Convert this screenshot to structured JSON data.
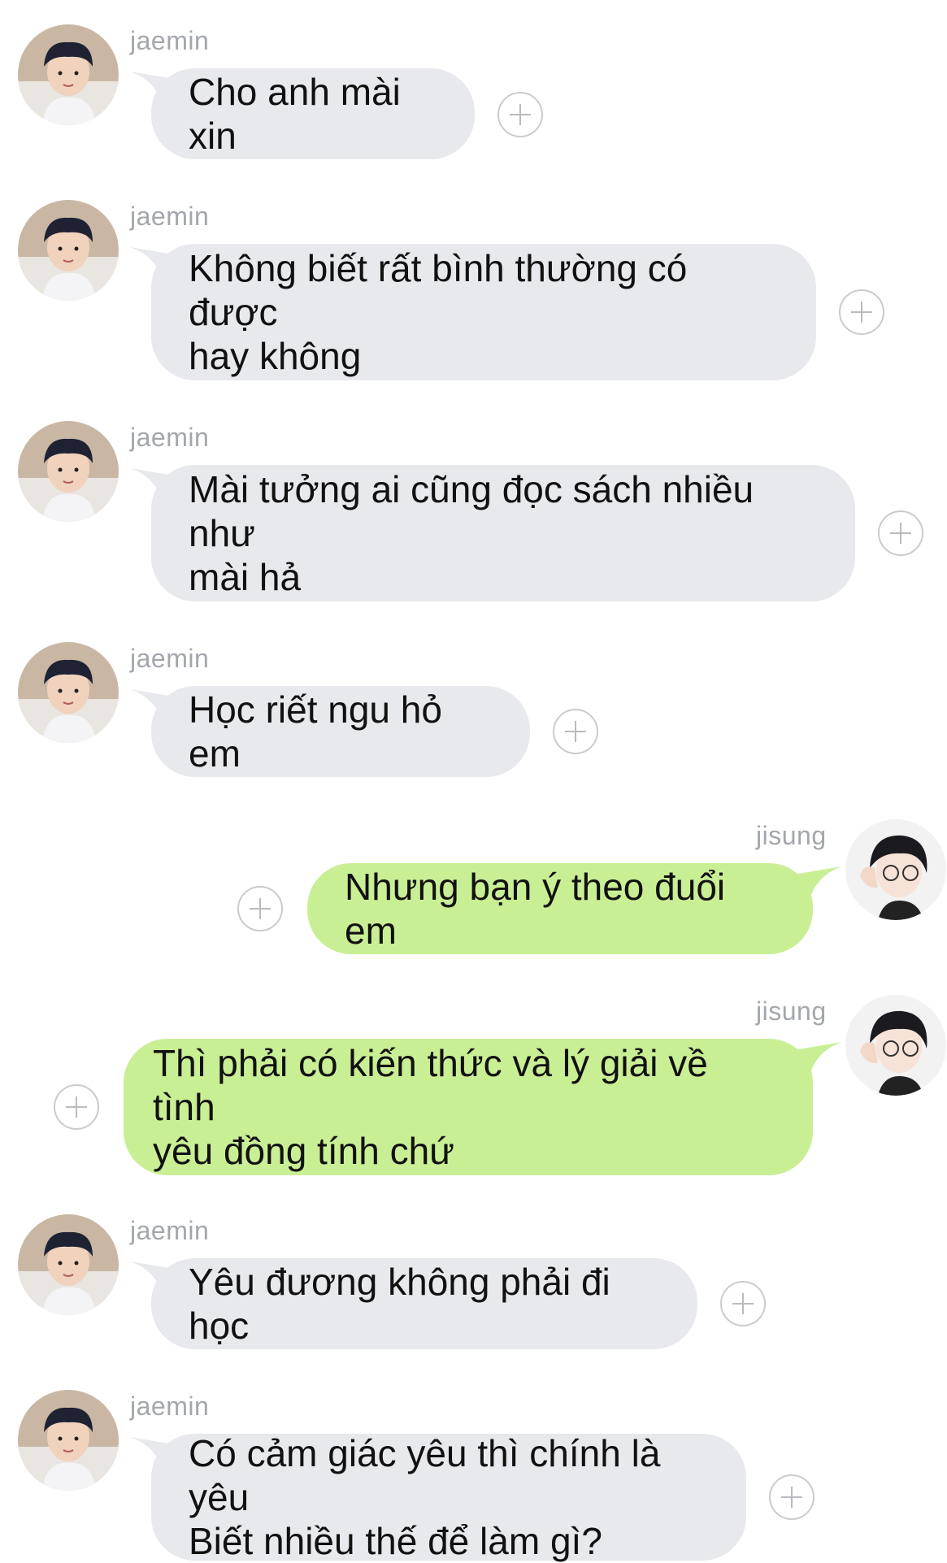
{
  "chat": {
    "messages": [
      {
        "sender": "jaemin",
        "text": "Cho anh mài xin"
      },
      {
        "sender": "jaemin",
        "text": "Không biết rất bình thường có được\nhay không"
      },
      {
        "sender": "jaemin",
        "text": "Mài tưởng ai cũng đọc sách nhiều như\nmài hả"
      },
      {
        "sender": "jaemin",
        "text": "Học riết ngu hỏ em"
      },
      {
        "sender": "jisung",
        "text": "Nhưng bạn ý theo đuổi em"
      },
      {
        "sender": "jisung",
        "text": "Thì phải có kiến thức và lý giải về tình\nyêu đồng tính chứ"
      },
      {
        "sender": "jaemin",
        "text": "Yêu đương không phải đi học"
      },
      {
        "sender": "jaemin",
        "text": "Có cảm giác yêu thì chính là yêu\nBiết nhiều thế để làm gì?"
      }
    ]
  },
  "icons": {
    "add_reaction": "plus-circle-icon",
    "avatar": "avatar-photo"
  },
  "colors": {
    "incoming_bubble": "#e8e9ed",
    "outgoing_bubble": "#c9ef95",
    "name_label": "#a3a7ad"
  }
}
